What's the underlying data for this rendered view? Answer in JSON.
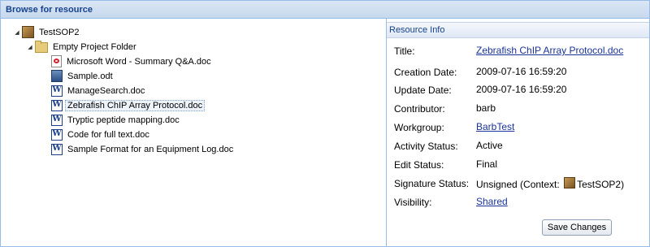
{
  "dialog": {
    "title": "Browse for resource"
  },
  "tree": {
    "root": {
      "label": "TestSOP2",
      "icon": "package-icon"
    },
    "folder": {
      "label": "Empty Project Folder",
      "icon": "folder-icon"
    },
    "items": [
      {
        "label": "Microsoft Word - Summary Q&A.doc",
        "icon": "pdf-icon"
      },
      {
        "label": "Sample.odt",
        "icon": "odt-document-icon"
      },
      {
        "label": "ManageSearch.doc",
        "icon": "word-document-icon"
      },
      {
        "label": "Zebrafish ChIP Array Protocol.doc",
        "icon": "word-document-icon",
        "selected": true
      },
      {
        "label": "Tryptic peptide mapping.doc",
        "icon": "word-document-icon"
      },
      {
        "label": "Code for full text.doc",
        "icon": "word-document-icon"
      },
      {
        "label": "Sample Format for an Equipment Log.doc",
        "icon": "word-document-icon"
      }
    ]
  },
  "info": {
    "header": "Resource Info",
    "fields": {
      "title": {
        "label": "Title:",
        "value": "Zebrafish ChIP Array Protocol.doc"
      },
      "creation_date": {
        "label": "Creation Date:",
        "value": "2009-07-16 16:59:20"
      },
      "update_date": {
        "label": "Update Date:",
        "value": "2009-07-16 16:59:20"
      },
      "contributor": {
        "label": "Contributor:",
        "value": "barb"
      },
      "workgroup": {
        "label": "Workgroup:",
        "value": "BarbTest"
      },
      "activity_status": {
        "label": "Activity Status:",
        "value": "Active"
      },
      "edit_status": {
        "label": "Edit Status:",
        "value": "Final"
      },
      "signature_status": {
        "label": "Signature Status:",
        "value_prefix": "Unsigned (Context:",
        "context": "TestSOP2",
        "value_suffix": ")"
      },
      "visibility": {
        "label": "Visibility:",
        "value": "Shared"
      }
    },
    "save_label": "Save Changes"
  }
}
